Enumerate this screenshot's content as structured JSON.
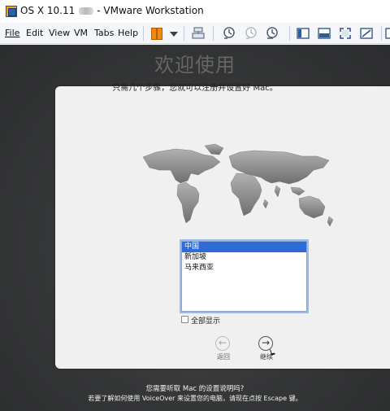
{
  "window": {
    "title_left": "OS X 10.11",
    "title_right": "- VMware Workstation"
  },
  "menu": {
    "file": "File",
    "edit": "Edit",
    "view": "View",
    "vm": "VM",
    "tabs": "Tabs",
    "help": "Help"
  },
  "toolbar_icons": [
    "pause-icon",
    "dropdown-arrow-icon",
    "send-ctrl-alt-del-icon",
    "snapshot-icon",
    "revert-snapshot-icon",
    "manage-snapshots-icon",
    "sidebar-view-icon",
    "console-view-icon",
    "full-screen-icon",
    "unity-view-icon",
    "library-icon"
  ],
  "setup": {
    "heading": "欢迎使用",
    "subtitle": "只需几个步骤，您就可以注册并设置好 Mac。",
    "countries": [
      "中国",
      "新加坡",
      "马来西亚"
    ],
    "selected_country": "中国",
    "show_all_label": "全部显示",
    "back_label": "返回",
    "continue_label": "继续",
    "voice_prompt": "您需要听取 Mac 的设置说明吗?",
    "voiceover_hint": "若要了解如何使用 VoiceOver 来设置您的电脑，请现在点按 Escape 键。"
  },
  "colors": {
    "vm_background": "#363738",
    "panel_background": "#f0f0f0",
    "selection_blue": "#2f6bd7",
    "pause_orange": "#f08a12"
  }
}
